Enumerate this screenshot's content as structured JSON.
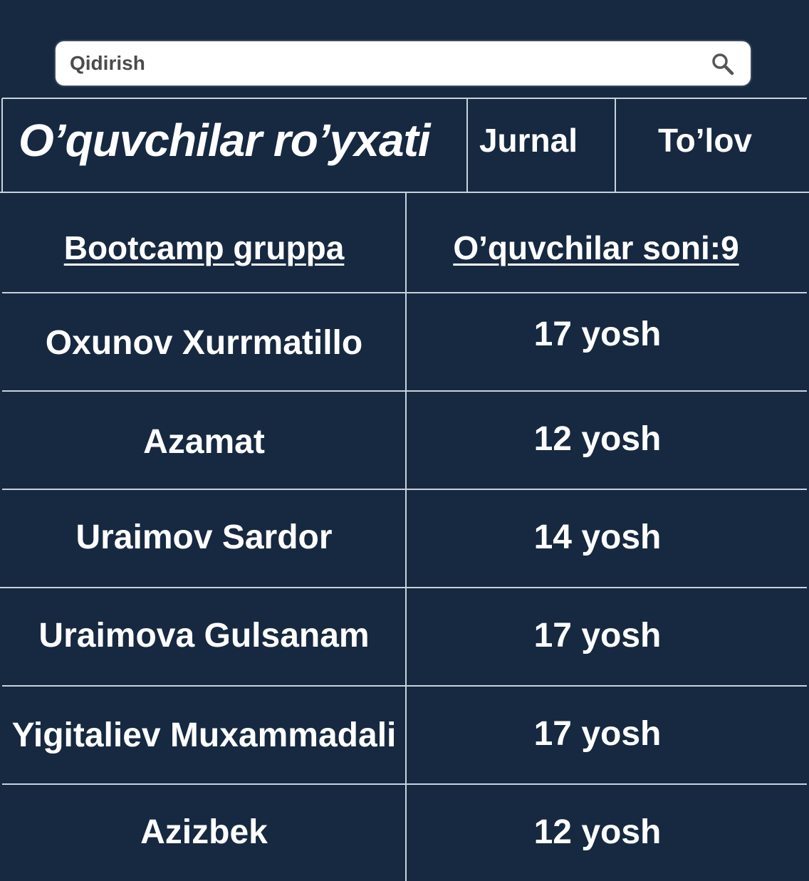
{
  "search": {
    "placeholder": "Qidirish",
    "icon": "search-icon"
  },
  "header": {
    "title": "O’quvchilar ro’yxati",
    "tabs": [
      {
        "label": "Jurnal"
      },
      {
        "label": "To’lov"
      }
    ]
  },
  "table": {
    "group_label": "Bootcamp gruppa",
    "count_label": "O’quvchilar soni:9",
    "rows": [
      {
        "name": "Oxunov Xurrmatillo",
        "age": "17 yosh"
      },
      {
        "name": "Azamat",
        "age": "12 yosh"
      },
      {
        "name": "Uraimov Sardor",
        "age": "14 yosh"
      },
      {
        "name": "Uraimova Gulsanam",
        "age": "17 yosh"
      },
      {
        "name": "Yigitaliev Muxammadali",
        "age": "17 yosh"
      },
      {
        "name": "Azizbek",
        "age": "12 yosh"
      }
    ]
  },
  "colors": {
    "background": "#162941",
    "text": "#ffffff",
    "grid_line": "#c9d2dc",
    "search_bg": "#ffffff",
    "search_text": "#4b4b4b"
  }
}
